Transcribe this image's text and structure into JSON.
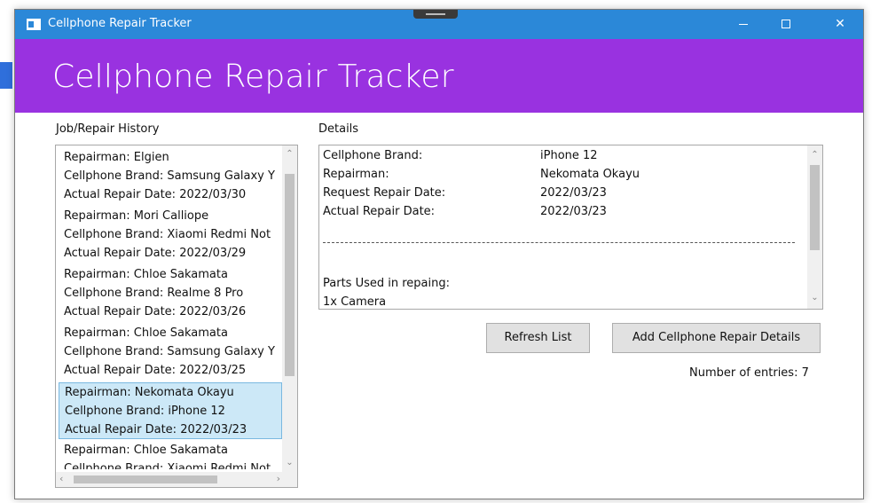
{
  "window": {
    "title": "Cellphone Repair Tracker",
    "banner_title": "Cellphone Repair Tracker",
    "colors": {
      "titlebar": "#2b88d8",
      "banner": "#9932e0",
      "selection": "#cce8f7"
    }
  },
  "history": {
    "label": "Job/Repair History",
    "items": [
      {
        "repairman": "Repairman: Elgien",
        "brand": "Cellphone Brand: Samsung Galaxy Y",
        "date": "Actual Repair Date:  2022/03/30",
        "selected": false
      },
      {
        "repairman": "Repairman: Mori Calliope",
        "brand": "Cellphone Brand: Xiaomi Redmi Not",
        "date": "Actual Repair Date:  2022/03/29",
        "selected": false
      },
      {
        "repairman": "Repairman: Chloe Sakamata",
        "brand": "Cellphone Brand: Realme 8 Pro",
        "date": "Actual Repair Date:  2022/03/26",
        "selected": false
      },
      {
        "repairman": "Repairman: Chloe Sakamata",
        "brand": "Cellphone Brand: Samsung Galaxy Y",
        "date": "Actual Repair Date:  2022/03/25",
        "selected": false
      },
      {
        "repairman": "Repairman: Nekomata Okayu",
        "brand": "Cellphone Brand: iPhone 12",
        "date": "Actual Repair Date:  2022/03/23",
        "selected": true
      },
      {
        "repairman": "Repairman: Chloe Sakamata",
        "brand": "Cellphone Brand: Xiaomi Redmi Not",
        "date": "",
        "selected": false
      }
    ]
  },
  "details": {
    "label": "Details",
    "fields": [
      {
        "key": "Cellphone Brand:",
        "value": "iPhone 12"
      },
      {
        "key": "Repairman:",
        "value": "Nekomata Okayu"
      },
      {
        "key": "Request Repair Date:",
        "value": "2022/03/23"
      },
      {
        "key": "Actual Repair Date:",
        "value": "2022/03/23"
      }
    ],
    "parts_header": "Parts Used in repaing:",
    "parts": [
      "1x   Camera"
    ]
  },
  "buttons": {
    "refresh": "Refresh List",
    "add": "Add Cellphone Repair Details"
  },
  "entries_text": "Number of entries: 7",
  "icons": {
    "minimize": "minimize-icon",
    "maximize": "maximize-icon",
    "close": "close-icon",
    "scroll_up": "chevron-up-icon",
    "scroll_down": "chevron-down-icon",
    "scroll_left": "chevron-left-icon",
    "scroll_right": "chevron-right-icon"
  }
}
